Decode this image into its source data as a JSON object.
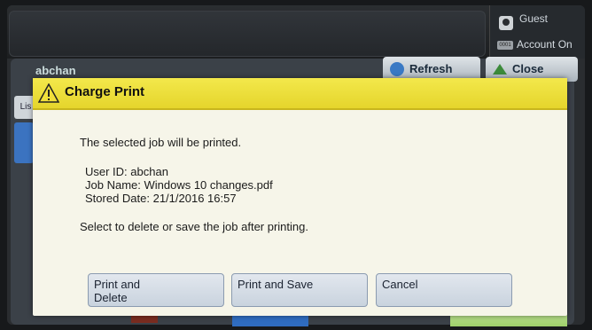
{
  "topbar": {
    "guest_label": "Guest",
    "account_icon_text": "0001",
    "account_label": "Account On"
  },
  "background": {
    "user_label": "abchan",
    "refresh_label": "Refresh",
    "close_label": "Close",
    "left_tab_label": "Lis"
  },
  "dialog": {
    "title": "Charge Print",
    "message": "The selected job will be printed.",
    "details": [
      "User ID: abchan",
      "Job Name: Windows 10 changes.pdf",
      "Stored Date: 21/1/2016 16:57"
    ],
    "note": "Select to delete or save the job after printing.",
    "buttons": {
      "print_delete_line1": "Print and",
      "print_delete_line2": "Delete",
      "print_save": "Print and Save",
      "cancel": "Cancel"
    }
  },
  "colors": {
    "header_yellow": "#eede3a",
    "dialog_bg": "#f6f5e9",
    "button_bg": "#d6dee8",
    "screen_bg": "#2a2d30"
  }
}
